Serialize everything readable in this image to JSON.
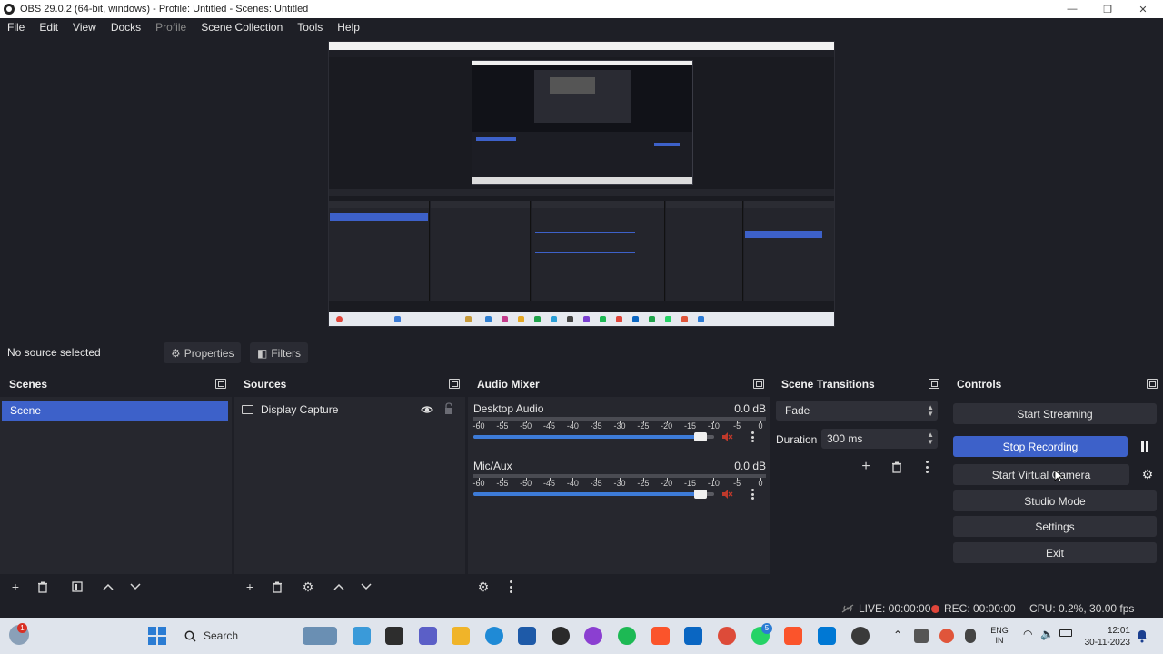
{
  "window": {
    "title": "OBS 29.0.2 (64-bit, windows) - Profile: Untitled - Scenes: Untitled",
    "minimize_glyph": "—",
    "restore_glyph": "❐",
    "close_glyph": "✕"
  },
  "menu": {
    "items": [
      "File",
      "Edit",
      "View",
      "Docks",
      "Profile",
      "Scene Collection",
      "Tools",
      "Help"
    ]
  },
  "source_toolbar": {
    "no_source": "No source selected",
    "properties": "Properties",
    "filters": "Filters"
  },
  "scenes": {
    "header": "Scenes",
    "items": [
      "Scene"
    ]
  },
  "sources": {
    "header": "Sources",
    "items": [
      {
        "name": "Display Capture",
        "icon": "monitor-icon",
        "visible": true,
        "locked": false
      }
    ]
  },
  "audio_mixer": {
    "header": "Audio Mixer",
    "channels": [
      {
        "name": "Desktop Audio",
        "level": "0.0 dB",
        "volume": 0.97
      },
      {
        "name": "Mic/Aux",
        "level": "0.0 dB",
        "volume": 0.97
      }
    ],
    "scale_labels": [
      "-60",
      "-55",
      "-50",
      "-45",
      "-40",
      "-35",
      "-30",
      "-25",
      "-20",
      "-15",
      "-10",
      "-5",
      "0"
    ]
  },
  "scene_transitions": {
    "header": "Scene Transitions",
    "transition": "Fade",
    "duration_label": "Duration",
    "duration_value": "300 ms"
  },
  "controls": {
    "header": "Controls",
    "start_streaming": "Start Streaming",
    "stop_recording": "Stop Recording",
    "start_virtual_camera": "Start Virtual Camera",
    "studio_mode": "Studio Mode",
    "settings": "Settings",
    "exit": "Exit"
  },
  "status": {
    "live": "LIVE: 00:00:00",
    "rec": "REC: 00:00:00",
    "cpu": "CPU: 0.2%, 30.00 fps"
  },
  "taskbar": {
    "search_placeholder": "Search",
    "notification_count": "1",
    "language_top": "ENG",
    "language_bottom": "IN",
    "time": "12:01",
    "date": "30-11-2023",
    "chat_badge": "5"
  },
  "colors": {
    "accent": "#3d61c9",
    "background": "#1e1f26",
    "panel": "#26272e",
    "record": "#e0453a"
  }
}
